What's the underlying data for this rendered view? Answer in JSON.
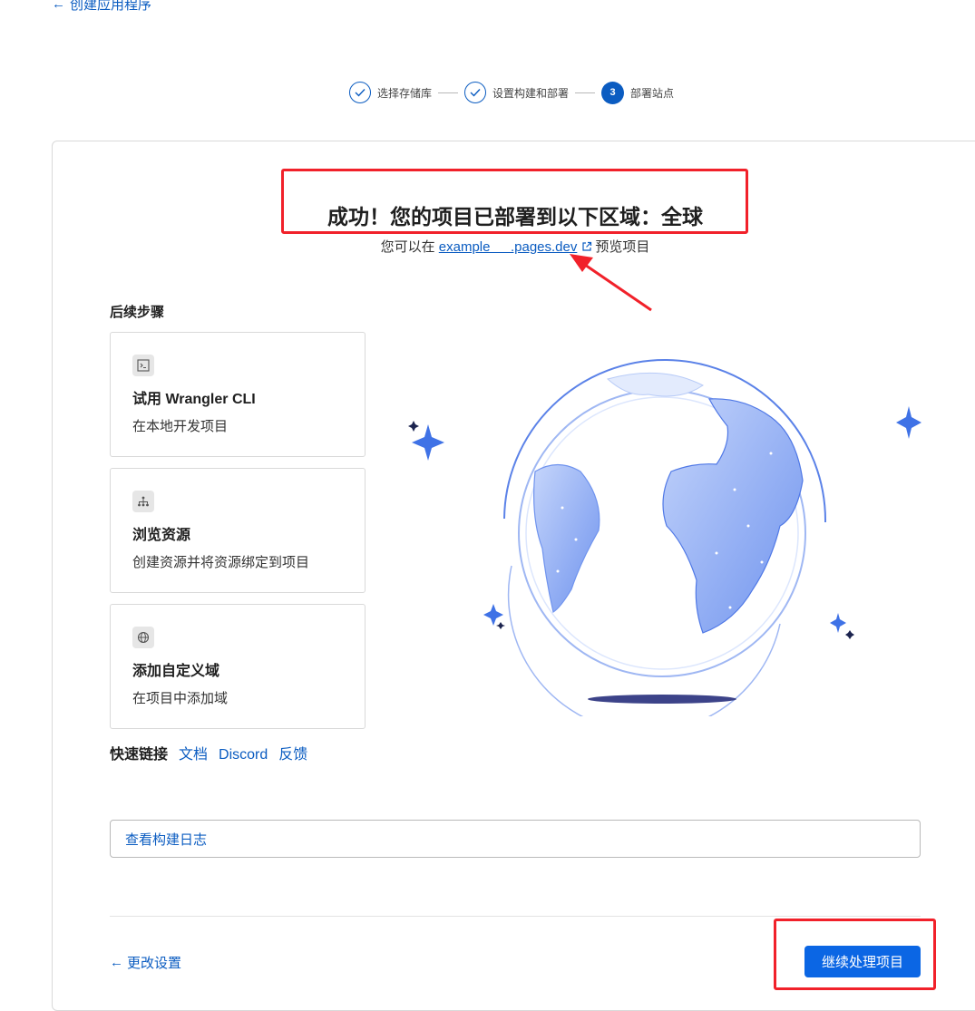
{
  "header": {
    "back_label": "创建应用程序"
  },
  "stepper": {
    "steps": [
      {
        "label": "选择存储库",
        "state": "done"
      },
      {
        "label": "设置构建和部署",
        "state": "done"
      },
      {
        "label": "部署站点",
        "state": "current",
        "number": "3"
      }
    ]
  },
  "success": {
    "title": "成功！您的项目已部署到以下区域：全球",
    "prefix": "您可以在",
    "domain": "example   .pages.dev",
    "suffix": "预览项目"
  },
  "next_steps": {
    "heading": "后续步骤",
    "cards": [
      {
        "icon": "terminal-icon",
        "title": "试用 Wrangler CLI",
        "desc": "在本地开发项目"
      },
      {
        "icon": "resources-icon",
        "title": "浏览资源",
        "desc": "创建资源并将资源绑定到项目"
      },
      {
        "icon": "globe-icon",
        "title": "添加自定义域",
        "desc": "在项目中添加域"
      }
    ]
  },
  "quick_links": {
    "label": "快速链接",
    "items": [
      "文档",
      "Discord",
      "反馈"
    ]
  },
  "build_log": {
    "label": "查看构建日志"
  },
  "footer": {
    "change_settings": "更改设置",
    "continue": "继续处理项目"
  },
  "colors": {
    "accent": "#0b5cc1",
    "button": "#0b66e4",
    "annotation": "#f1212a",
    "globe": "#7c9ef0"
  }
}
